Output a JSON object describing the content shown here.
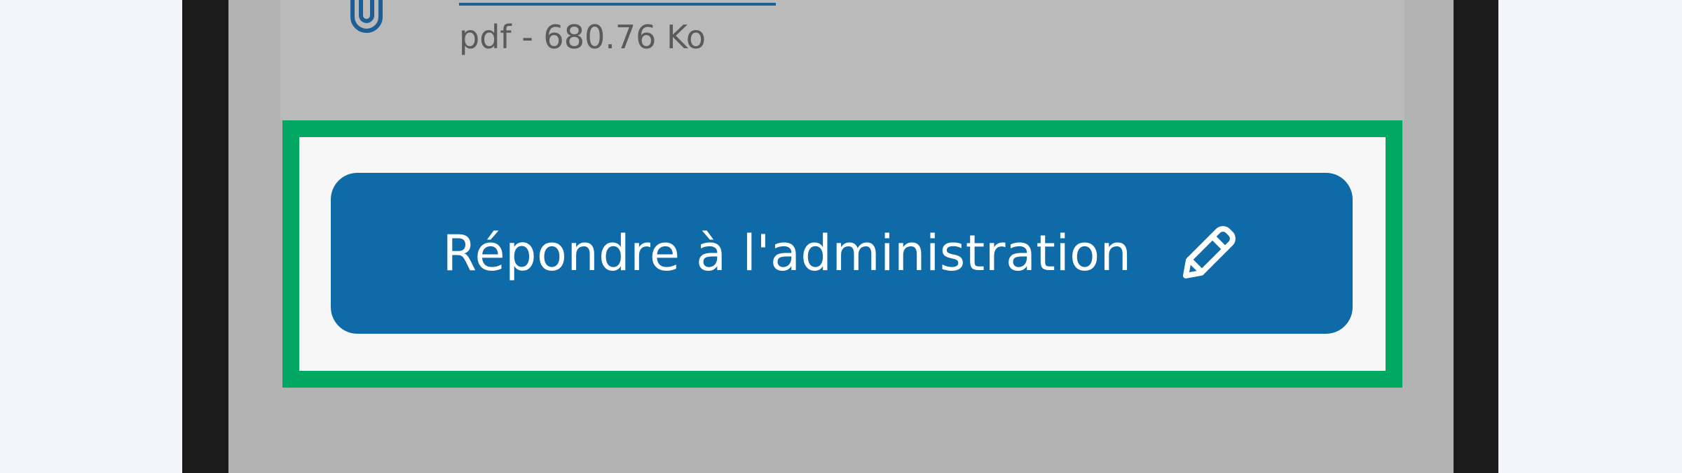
{
  "attachment": {
    "icon": "paperclip-icon",
    "meta": "pdf - 680.76 Ko",
    "link_color": "#1d5f95"
  },
  "reply_button": {
    "label": "Répondre à l'administration",
    "icon": "pencil-icon",
    "background": "#0e6ba8",
    "text_color": "#ffffff"
  },
  "focus_outline": {
    "color": "#00a861"
  }
}
